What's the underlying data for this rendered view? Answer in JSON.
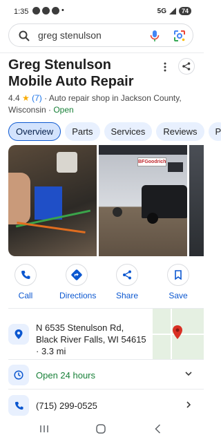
{
  "status_bar": {
    "time": "1:35",
    "network": "5G",
    "battery": "74"
  },
  "search": {
    "query": "greg stenulson"
  },
  "business": {
    "name": "Greg Stenulson Mobile Auto Repair",
    "rating": "4.4",
    "star": "★",
    "reviews": "(7)",
    "category": " · Auto repair shop in Jackson County, Wisconsin · ",
    "open_status": "Open"
  },
  "tabs": [
    {
      "label": "Overview",
      "active": true
    },
    {
      "label": "Parts"
    },
    {
      "label": "Services"
    },
    {
      "label": "Reviews"
    },
    {
      "label": "P"
    }
  ],
  "photos": {
    "storefront_sign": "BFGoodrich"
  },
  "actions": [
    {
      "label": "Call",
      "icon": "phone-icon"
    },
    {
      "label": "Directions",
      "icon": "directions-icon"
    },
    {
      "label": "Share",
      "icon": "share-icon"
    },
    {
      "label": "Save",
      "icon": "bookmark-icon"
    }
  ],
  "address": {
    "line": "N 6535 Stenulson Rd, Black River Falls, WI 54615",
    "distance": " · 3.3 mi"
  },
  "hours": {
    "text": "Open 24 hours"
  },
  "phone": {
    "number": "(715) 299-0525"
  },
  "colors": {
    "accent": "#0b57d0",
    "open": "#188038",
    "pin": "#d93025"
  }
}
